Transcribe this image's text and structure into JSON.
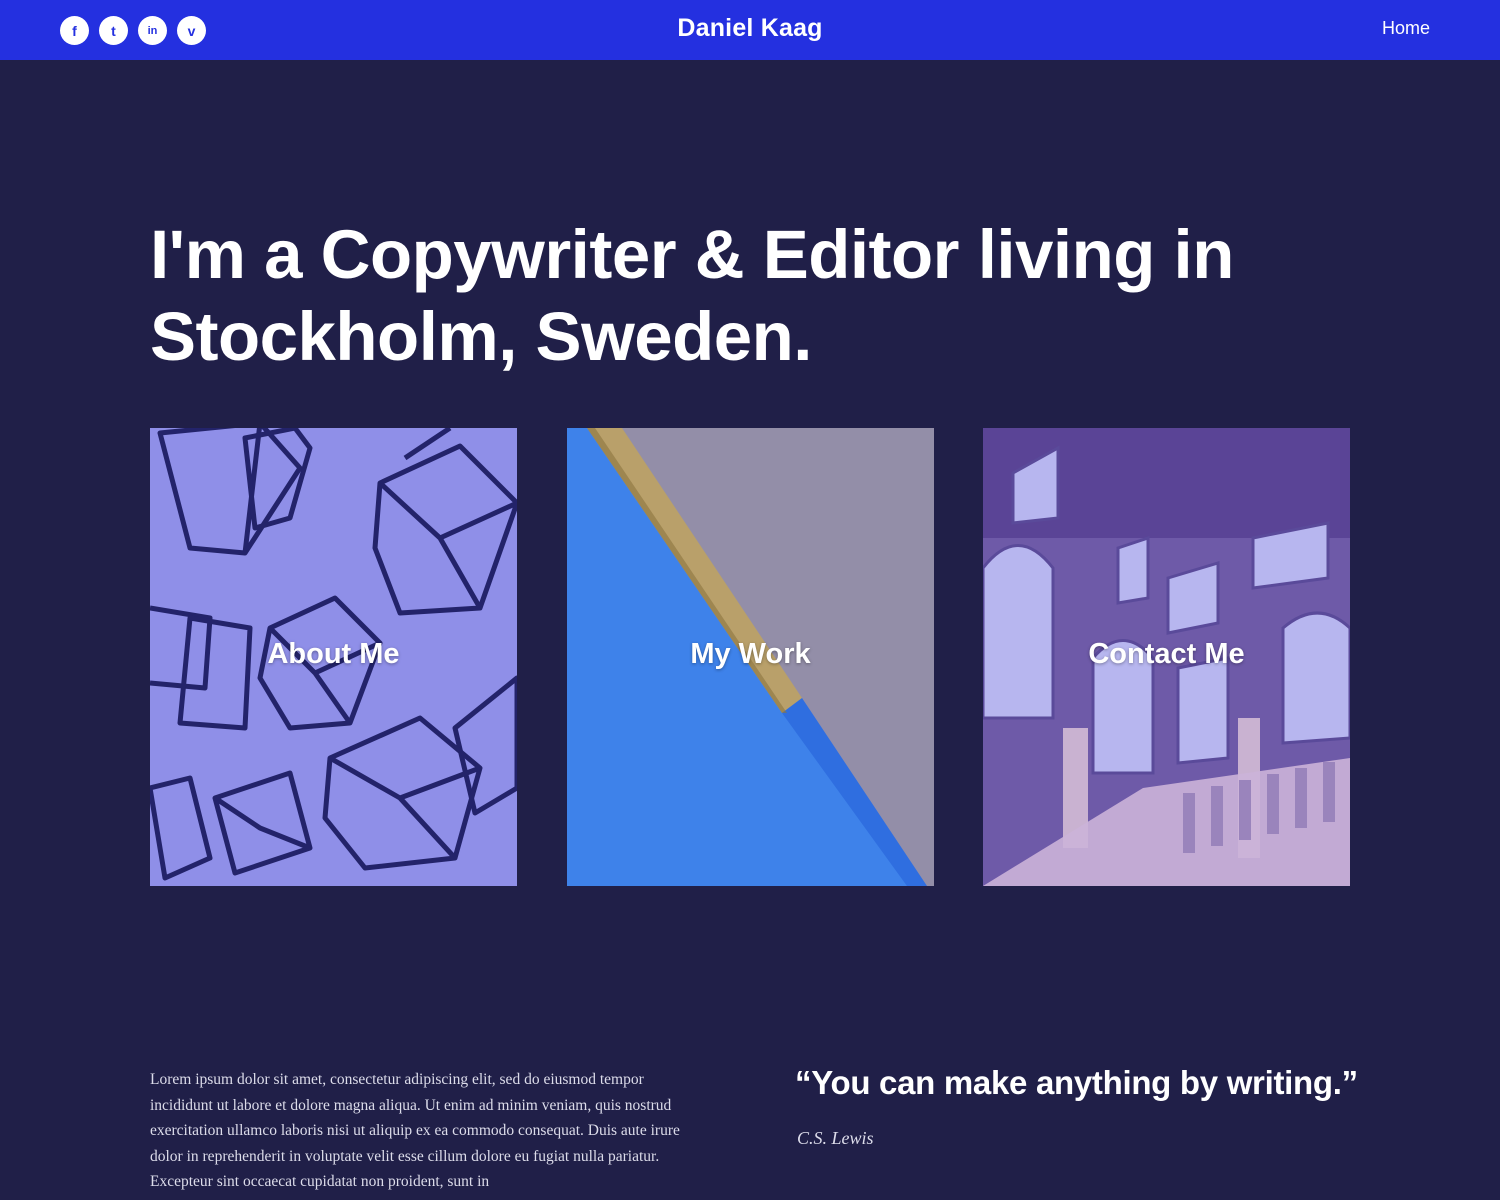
{
  "header": {
    "brand": "Daniel Kaag",
    "nav_home": "Home",
    "social": [
      {
        "icon": "facebook-icon",
        "glyph": "f"
      },
      {
        "icon": "twitter-icon",
        "glyph": "t"
      },
      {
        "icon": "linkedin-icon",
        "glyph": "in"
      },
      {
        "icon": "vimeo-icon",
        "glyph": "v"
      }
    ]
  },
  "hero": {
    "title": "I'm a Copywriter & Editor living in Stockholm, Sweden."
  },
  "cards": [
    {
      "label": "About Me",
      "image": "wireframe-cubes"
    },
    {
      "label": "My Work",
      "image": "pencil-on-blue"
    },
    {
      "label": "Contact Me",
      "image": "palace-staircase"
    }
  ],
  "intro_text": "Lorem ipsum dolor sit amet, consectetur adipiscing elit, sed do eiusmod tempor incididunt ut labore et dolore magna aliqua. Ut enim ad minim veniam, quis nostrud exercitation ullamco laboris nisi ut aliquip ex ea commodo consequat. Duis aute irure dolor in reprehenderit in voluptate velit esse cillum dolore eu fugiat nulla pariatur. Excepteur sint occaecat cupidatat non proident, sunt in",
  "quote": {
    "text": "“You can make anything by writing.”",
    "author": "C.S. Lewis"
  },
  "colors": {
    "header_bg": "#2430e0",
    "page_bg": "#201f48",
    "card_tint": "#7a7ae6"
  }
}
